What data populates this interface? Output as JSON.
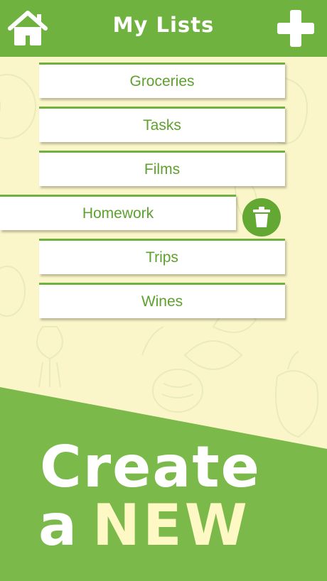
{
  "header": {
    "title": "My Lists",
    "home_icon": "home-icon",
    "add_icon": "plus-icon"
  },
  "lists": [
    {
      "label": "Groceries"
    },
    {
      "label": "Tasks"
    },
    {
      "label": "Films"
    },
    {
      "label": "Homework"
    },
    {
      "label": "Trips"
    },
    {
      "label": "Wines"
    }
  ],
  "delete_icon": "trash-icon",
  "promo": {
    "line1": "Create",
    "line2_a": "a",
    "line2_new": "NEW"
  },
  "colors": {
    "primary_green": "#6fb23f",
    "background": "#fbf6c9",
    "label_green": "#5ea12e"
  }
}
